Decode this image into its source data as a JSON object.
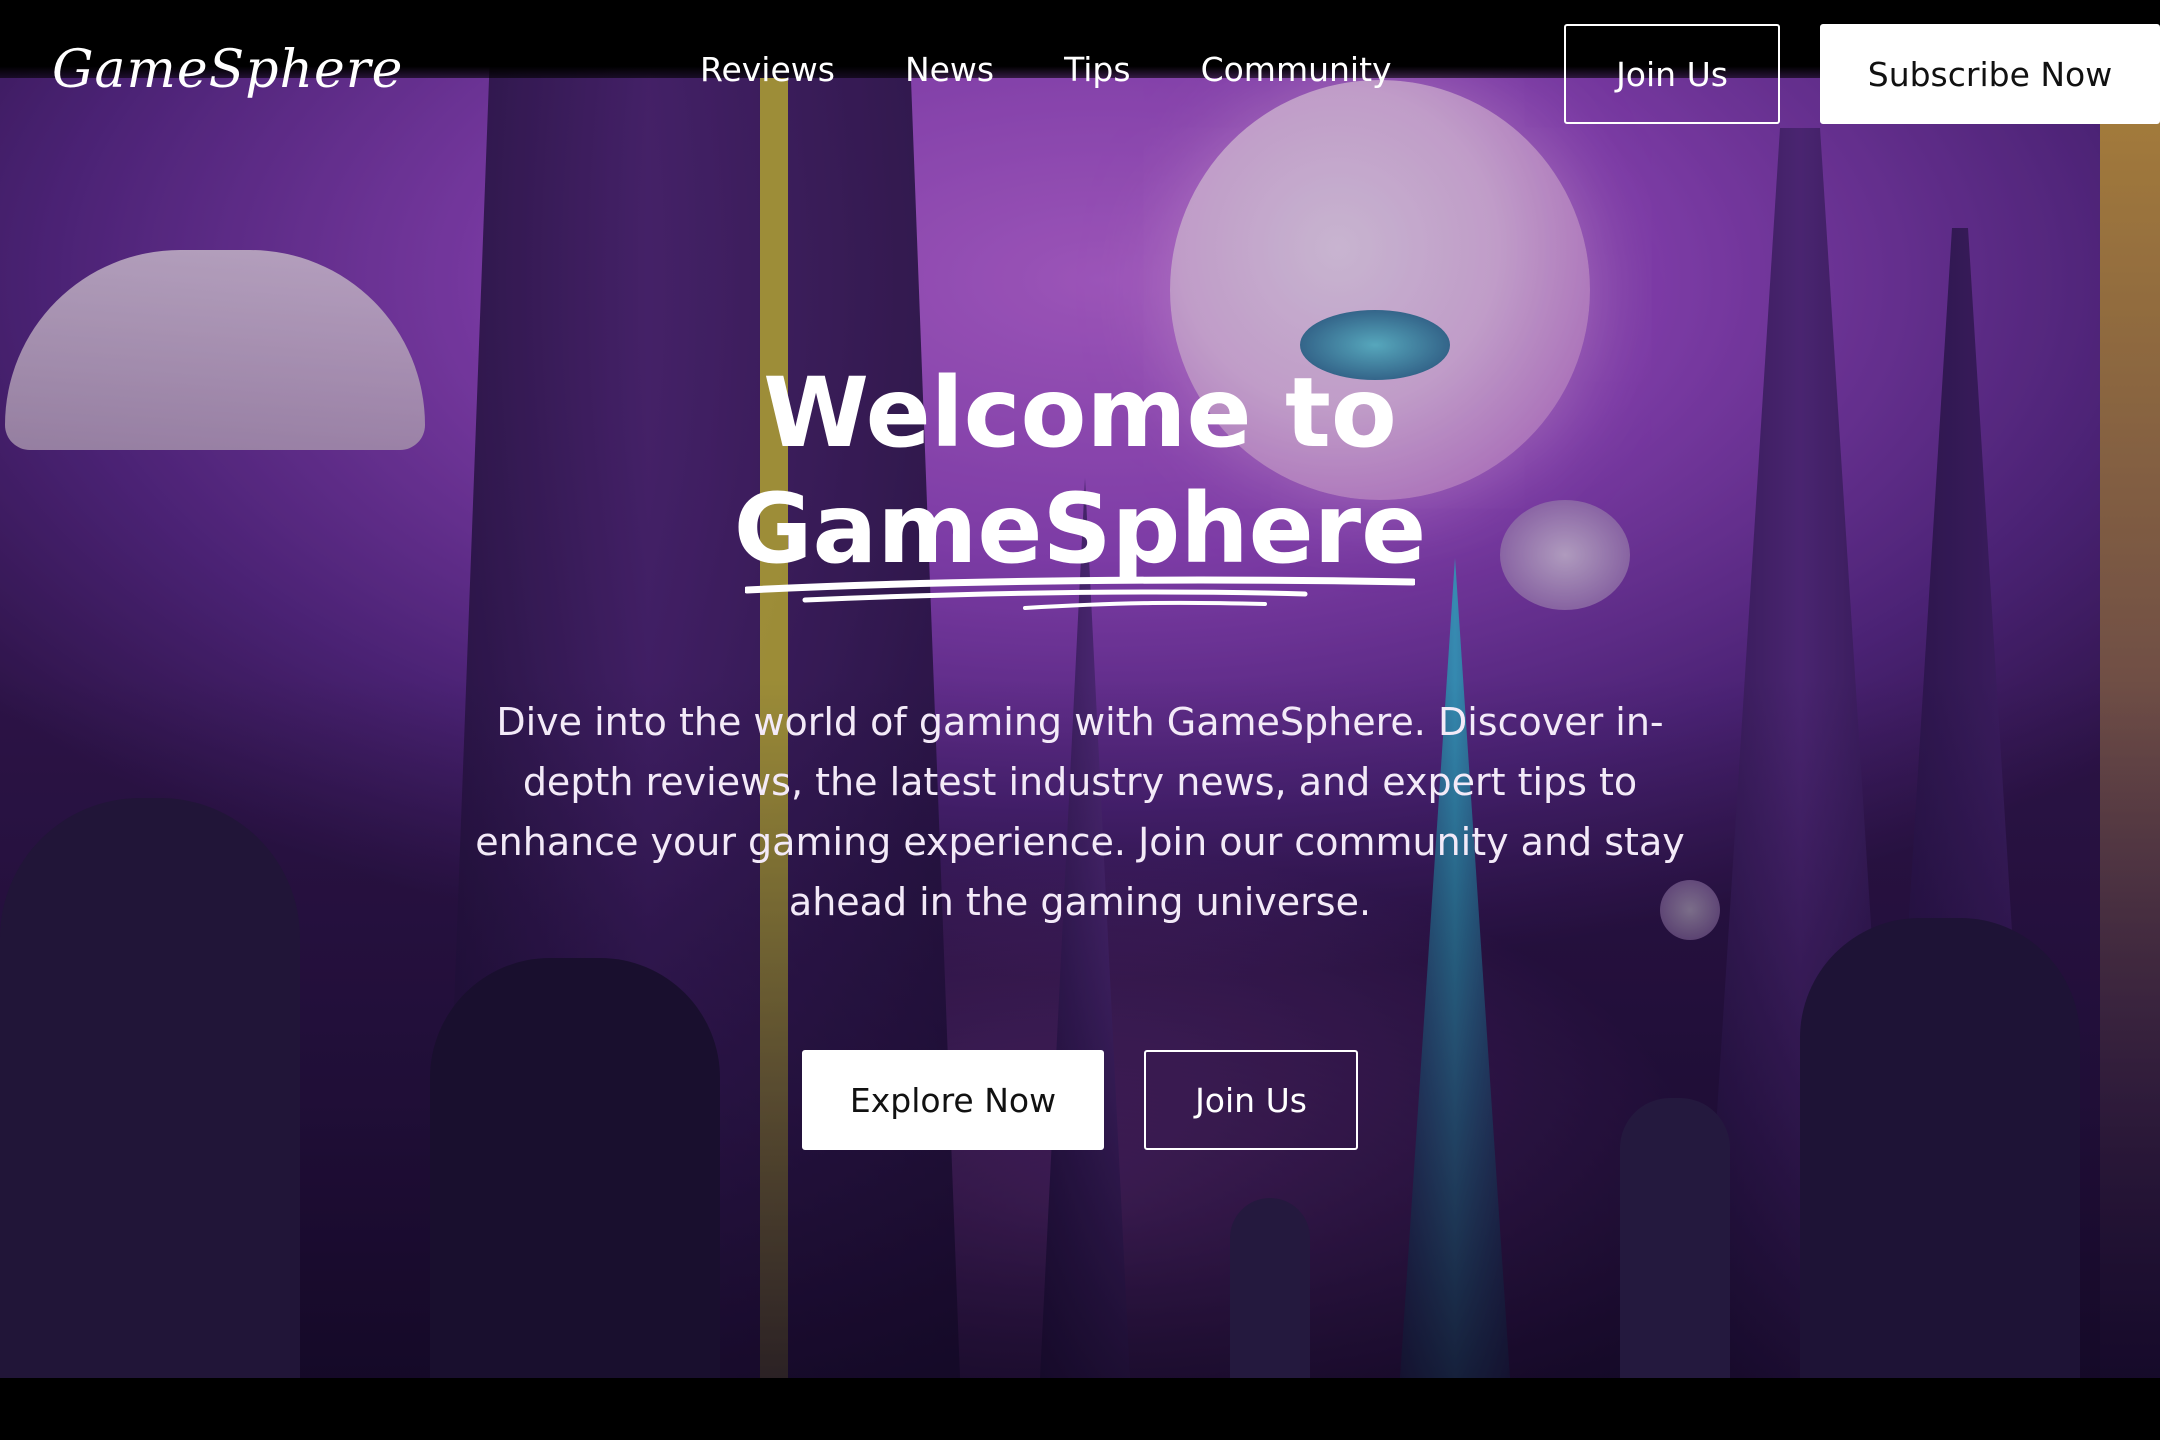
{
  "brand": {
    "logo": "GameSphere"
  },
  "nav": {
    "links": [
      "Reviews",
      "News",
      "Tips",
      "Community"
    ],
    "join_label": "Join Us",
    "subscribe_label": "Subscribe Now"
  },
  "hero": {
    "title_line1": "Welcome to",
    "title_line2": "GameSphere",
    "description": "Dive into the world of gaming with GameSphere. Discover in-depth reviews, the latest industry news, and expert tips to enhance your gaming experience. Join our community and stay ahead in the gaming universe.",
    "explore_label": "Explore Now",
    "join_label": "Join Us"
  },
  "colors": {
    "text": "#ffffff",
    "button_solid_bg": "#ffffff",
    "button_solid_text": "#111111",
    "background": "#000000",
    "accent_purple": "#9a4bc8"
  }
}
